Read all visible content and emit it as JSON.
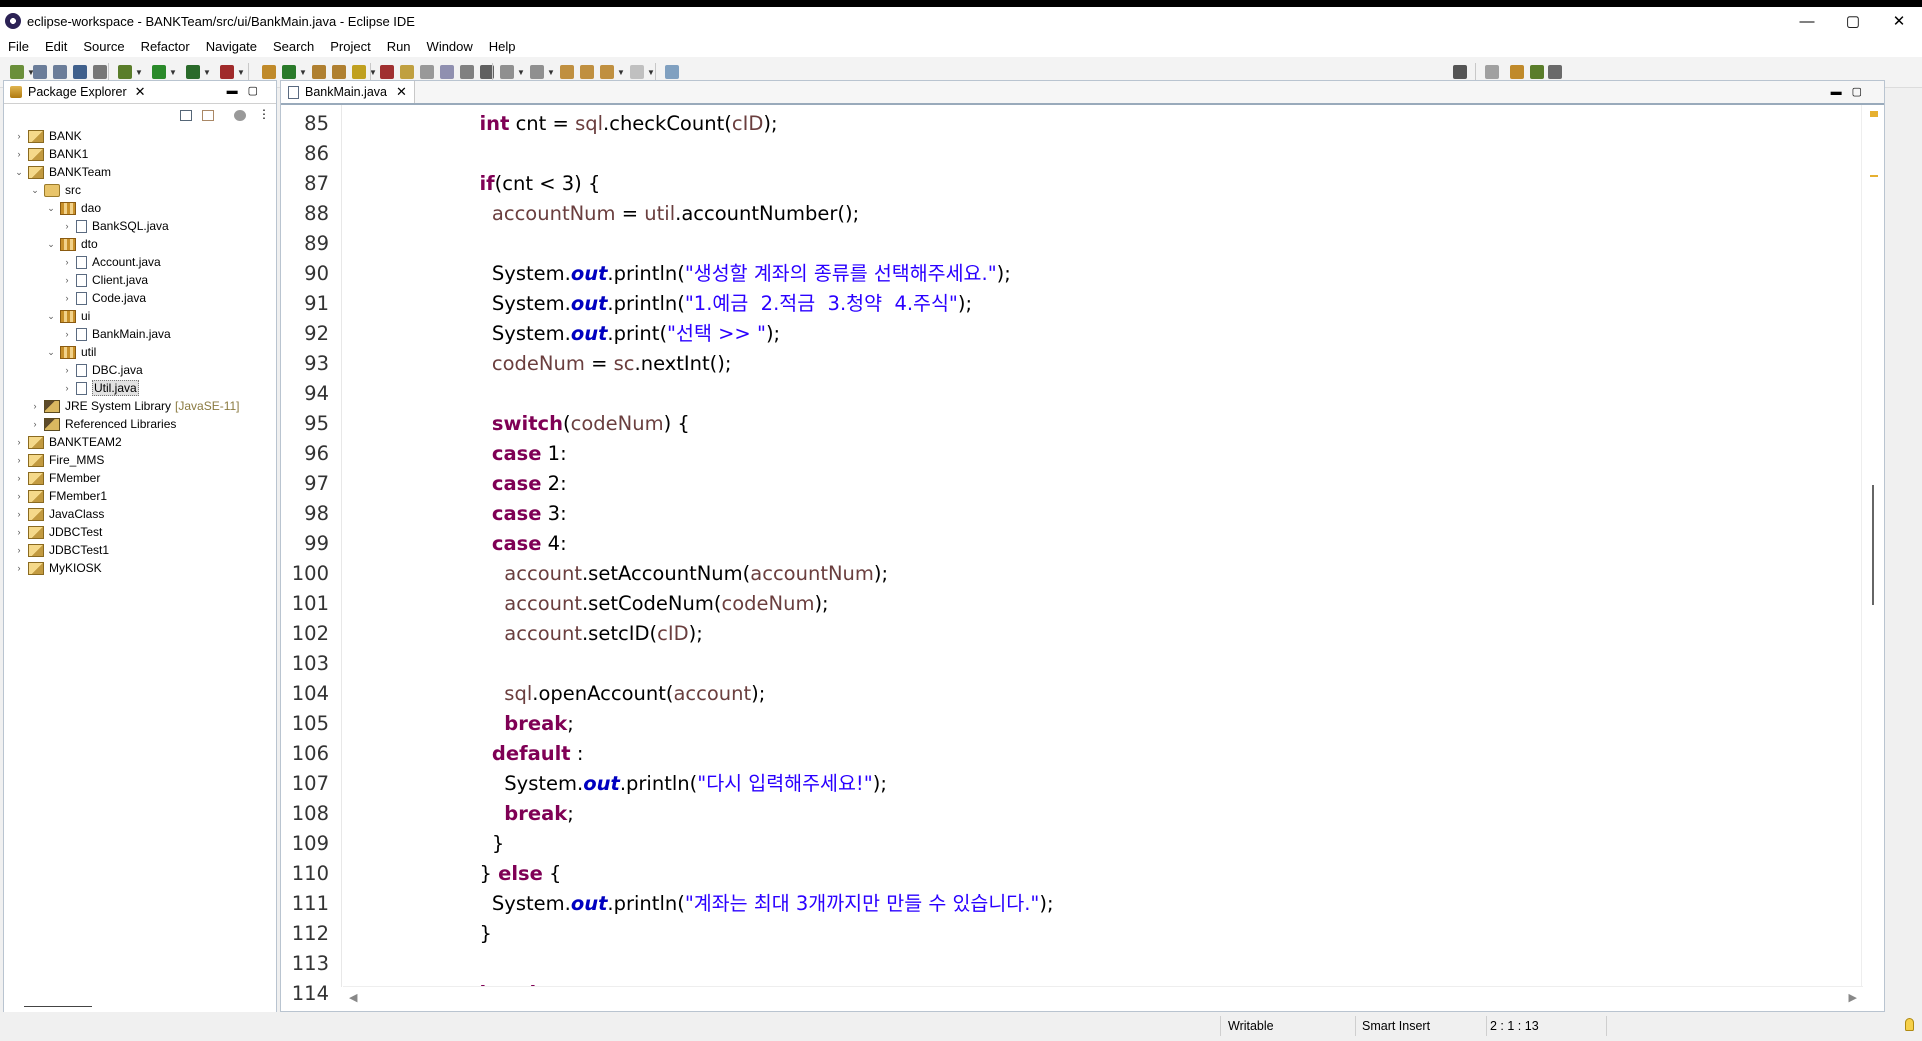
{
  "window": {
    "title": "eclipse-workspace - BANKTeam/src/ui/BankMain.java - Eclipse IDE",
    "minimize": "—",
    "maximize": "▢",
    "close": "✕"
  },
  "menu": [
    "File",
    "Edit",
    "Source",
    "Refactor",
    "Navigate",
    "Search",
    "Project",
    "Run",
    "Window",
    "Help"
  ],
  "package_explorer": {
    "tab_label": "Package Explorer",
    "close": "✕",
    "tree": [
      {
        "label": "BANK",
        "icon": "project-icon",
        "expanded": false
      },
      {
        "label": "BANK1",
        "icon": "project-icon",
        "expanded": false
      },
      {
        "label": "BANKTeam",
        "icon": "project-icon",
        "expanded": true
      },
      {
        "label": "src",
        "icon": "source-folder-icon",
        "expanded": true
      },
      {
        "label": "dao",
        "icon": "package-icon",
        "expanded": true
      },
      {
        "label": "BankSQL.java",
        "icon": "java-file-icon",
        "expanded": false
      },
      {
        "label": "dto",
        "icon": "package-icon",
        "expanded": true
      },
      {
        "label": "Account.java",
        "icon": "java-file-icon",
        "expanded": false
      },
      {
        "label": "Client.java",
        "icon": "java-file-icon",
        "expanded": false
      },
      {
        "label": "Code.java",
        "icon": "java-file-icon",
        "expanded": false
      },
      {
        "label": "ui",
        "icon": "package-icon",
        "expanded": true
      },
      {
        "label": "BankMain.java",
        "icon": "java-file-icon",
        "expanded": false
      },
      {
        "label": "util",
        "icon": "package-icon",
        "expanded": true
      },
      {
        "label": "DBC.java",
        "icon": "java-file-icon",
        "expanded": false
      },
      {
        "label": "Util.java",
        "icon": "java-file-icon",
        "expanded": false,
        "selected": true
      },
      {
        "label": "JRE System Library",
        "decoration": "[JavaSE-11]",
        "icon": "library-icon",
        "expanded": false
      },
      {
        "label": "Referenced Libraries",
        "icon": "library-icon",
        "expanded": false
      },
      {
        "label": "BANKTEAM2",
        "icon": "project-icon",
        "expanded": false
      },
      {
        "label": "Fire_MMS",
        "icon": "project-icon",
        "expanded": false
      },
      {
        "label": "FMember",
        "icon": "project-icon",
        "expanded": false
      },
      {
        "label": "FMember1",
        "icon": "project-icon",
        "expanded": false
      },
      {
        "label": "JavaClass",
        "icon": "project-icon",
        "expanded": false
      },
      {
        "label": "JDBCTest",
        "icon": "project-icon",
        "expanded": false
      },
      {
        "label": "JDBCTest1",
        "icon": "project-icon",
        "expanded": false
      },
      {
        "label": "MyKIOSK",
        "icon": "project-icon",
        "expanded": false
      }
    ]
  },
  "editor": {
    "tab_label": "BankMain.java",
    "close": "✕",
    "lines": [
      {
        "n": "85",
        "segs": [
          [
            "kw",
            "int"
          ],
          [
            "p",
            " cnt = "
          ],
          [
            "var",
            "sql"
          ],
          [
            "p",
            ".checkCount("
          ],
          [
            "var",
            "cID"
          ],
          [
            "p",
            ");"
          ]
        ]
      },
      {
        "n": "86",
        "segs": []
      },
      {
        "n": "87",
        "segs": [
          [
            "kw",
            "if"
          ],
          [
            "p",
            "(cnt < 3) {"
          ]
        ]
      },
      {
        "n": "88",
        "segs": [
          [
            "p",
            "  "
          ],
          [
            "var",
            "accountNum"
          ],
          [
            "p",
            " = "
          ],
          [
            "var",
            "util"
          ],
          [
            "p",
            ".accountNumber();"
          ]
        ]
      },
      {
        "n": "89",
        "segs": []
      },
      {
        "n": "90",
        "segs": [
          [
            "p",
            "  System."
          ],
          [
            "field",
            "out"
          ],
          [
            "p",
            ".println("
          ],
          [
            "str",
            "\"생성할 계좌의 종류를 선택해주세요.\""
          ],
          [
            "p",
            ");"
          ]
        ]
      },
      {
        "n": "91",
        "segs": [
          [
            "p",
            "  System."
          ],
          [
            "field",
            "out"
          ],
          [
            "p",
            ".println("
          ],
          [
            "str",
            "\"1.예금  2.적금  3.청약  4.주식\""
          ],
          [
            "p",
            ");"
          ]
        ]
      },
      {
        "n": "92",
        "segs": [
          [
            "p",
            "  System."
          ],
          [
            "field",
            "out"
          ],
          [
            "p",
            ".print("
          ],
          [
            "str",
            "\"선택 >> \""
          ],
          [
            "p",
            ");"
          ]
        ]
      },
      {
        "n": "93",
        "segs": [
          [
            "p",
            "  "
          ],
          [
            "var",
            "codeNum"
          ],
          [
            "p",
            " = "
          ],
          [
            "var",
            "sc"
          ],
          [
            "p",
            ".nextInt();"
          ]
        ]
      },
      {
        "n": "94",
        "segs": []
      },
      {
        "n": "95",
        "segs": [
          [
            "p",
            "  "
          ],
          [
            "kw",
            "switch"
          ],
          [
            "p",
            "("
          ],
          [
            "var",
            "codeNum"
          ],
          [
            "p",
            ") {"
          ]
        ]
      },
      {
        "n": "96",
        "segs": [
          [
            "p",
            "  "
          ],
          [
            "kw",
            "case"
          ],
          [
            "p",
            " 1:"
          ]
        ]
      },
      {
        "n": "97",
        "segs": [
          [
            "p",
            "  "
          ],
          [
            "kw",
            "case"
          ],
          [
            "p",
            " 2:"
          ]
        ]
      },
      {
        "n": "98",
        "segs": [
          [
            "p",
            "  "
          ],
          [
            "kw",
            "case"
          ],
          [
            "p",
            " 3:"
          ]
        ]
      },
      {
        "n": "99",
        "segs": [
          [
            "p",
            "  "
          ],
          [
            "kw",
            "case"
          ],
          [
            "p",
            " 4:"
          ]
        ]
      },
      {
        "n": "100",
        "segs": [
          [
            "p",
            "    "
          ],
          [
            "var",
            "account"
          ],
          [
            "p",
            ".setAccountNum("
          ],
          [
            "var",
            "accountNum"
          ],
          [
            "p",
            ");"
          ]
        ]
      },
      {
        "n": "101",
        "segs": [
          [
            "p",
            "    "
          ],
          [
            "var",
            "account"
          ],
          [
            "p",
            ".setCodeNum("
          ],
          [
            "var",
            "codeNum"
          ],
          [
            "p",
            ");"
          ]
        ]
      },
      {
        "n": "102",
        "segs": [
          [
            "p",
            "    "
          ],
          [
            "var",
            "account"
          ],
          [
            "p",
            ".setcID("
          ],
          [
            "var",
            "cID"
          ],
          [
            "p",
            ");"
          ]
        ]
      },
      {
        "n": "103",
        "segs": []
      },
      {
        "n": "104",
        "segs": [
          [
            "p",
            "    "
          ],
          [
            "var",
            "sql"
          ],
          [
            "p",
            ".openAccount("
          ],
          [
            "var",
            "account"
          ],
          [
            "p",
            ");"
          ]
        ]
      },
      {
        "n": "105",
        "segs": [
          [
            "p",
            "    "
          ],
          [
            "kw",
            "break"
          ],
          [
            "p",
            ";"
          ]
        ]
      },
      {
        "n": "106",
        "segs": [
          [
            "p",
            "  "
          ],
          [
            "kw",
            "default"
          ],
          [
            "p",
            " :"
          ]
        ]
      },
      {
        "n": "107",
        "segs": [
          [
            "p",
            "    System."
          ],
          [
            "field",
            "out"
          ],
          [
            "p",
            ".println("
          ],
          [
            "str",
            "\"다시 입력해주세요!\""
          ],
          [
            "p",
            ");"
          ]
        ]
      },
      {
        "n": "108",
        "segs": [
          [
            "p",
            "    "
          ],
          [
            "kw",
            "break"
          ],
          [
            "p",
            ";"
          ]
        ]
      },
      {
        "n": "109",
        "segs": [
          [
            "p",
            "  }"
          ]
        ]
      },
      {
        "n": "110",
        "segs": [
          [
            "p",
            "} "
          ],
          [
            "kw",
            "else"
          ],
          [
            "p",
            " {"
          ]
        ]
      },
      {
        "n": "111",
        "segs": [
          [
            "p",
            "  System."
          ],
          [
            "field",
            "out"
          ],
          [
            "p",
            ".println("
          ],
          [
            "str",
            "\"계좌는 최대 3개까지만 만들 수 있습니다.\""
          ],
          [
            "p",
            ");"
          ]
        ]
      },
      {
        "n": "112",
        "segs": [
          [
            "p",
            "}"
          ]
        ]
      },
      {
        "n": "113",
        "segs": []
      },
      {
        "n": "114",
        "segs": [
          [
            "kw",
            "break"
          ],
          [
            "p",
            ";"
          ]
        ]
      }
    ]
  },
  "status": {
    "writable": "Writable",
    "insert_mode": "Smart Insert",
    "position": "2 : 1 : 13"
  },
  "colors": {
    "keyword": "#7f0055",
    "string": "#2a00ff",
    "static_field": "#0000c0",
    "local_var": "#6a3e3e"
  }
}
